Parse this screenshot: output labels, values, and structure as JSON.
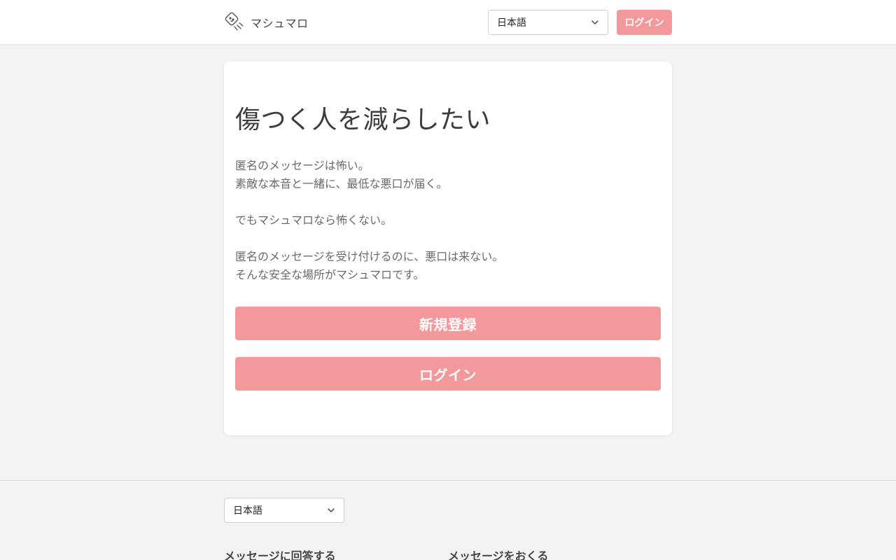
{
  "header": {
    "brand_name": "マシュマロ",
    "language": "日本語",
    "login_label": "ログイン"
  },
  "hero": {
    "title": "傷つく人を減らしたい",
    "paragraphs": [
      [
        "匿名のメッセージは怖い。",
        "素敵な本音と一緒に、最低な悪口が届く。"
      ],
      [
        "でもマシュマロなら怖くない。"
      ],
      [
        "匿名のメッセージを受け付けるのに、悪口は来ない。",
        "そんな安全な場所がマシュマロです。"
      ]
    ],
    "signup_label": "新規登録",
    "login_label": "ログイン"
  },
  "footer": {
    "language": "日本語",
    "headings": [
      "メッセージに回答する",
      "メッセージをおくる"
    ]
  },
  "colors": {
    "accent": "#f3989b",
    "background": "#f3f3f3",
    "card": "#ffffff",
    "title_text": "#3d3d3d",
    "body_text": "#6a6a6a"
  },
  "icons": {
    "brand": "marshmallow-logo-icon",
    "dropdown": "chevron-down-icon"
  }
}
